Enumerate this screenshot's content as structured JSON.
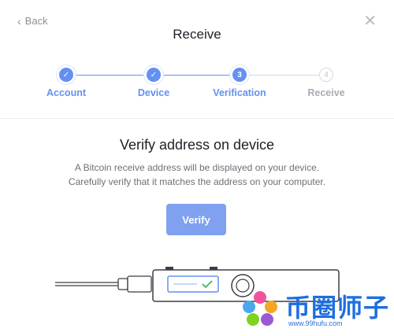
{
  "header": {
    "back_label": "Back",
    "back_icon": "chevron-left-icon",
    "close_icon": "close-icon",
    "title": "Receive"
  },
  "stepper": {
    "steps": [
      {
        "number": "1",
        "label": "Account",
        "state": "done"
      },
      {
        "number": "2",
        "label": "Device",
        "state": "done"
      },
      {
        "number": "3",
        "label": "Verification",
        "state": "active"
      },
      {
        "number": "4",
        "label": "Receive",
        "state": "pending"
      }
    ],
    "accent_color": "#6490f1"
  },
  "content": {
    "heading": "Verify address on device",
    "description_line1": "A Bitcoin receive address will be displayed on your device.",
    "description_line2": "Carefully verify that it matches the address on your computer.",
    "verify_label": "Verify"
  },
  "watermark": {
    "name": "币圈师子",
    "url": "www.99hufu.com"
  }
}
